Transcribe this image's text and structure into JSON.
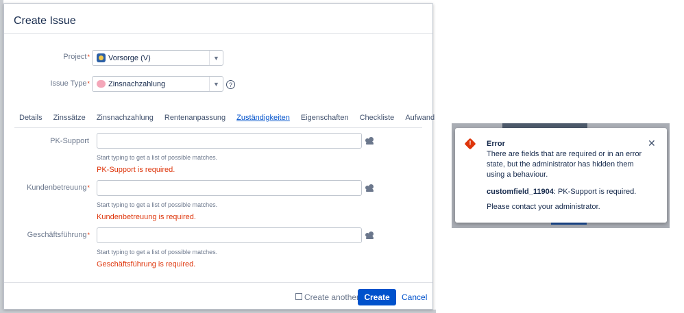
{
  "dialog": {
    "title": "Create Issue",
    "project": {
      "label": "Project",
      "required_mark": "*",
      "value": "Vorsorge (V)"
    },
    "issue_type": {
      "label": "Issue Type",
      "required_mark": "*",
      "value": "Zinsnachzahlung",
      "help": "?"
    },
    "tabs": [
      {
        "label": "Details"
      },
      {
        "label": "Zinssätze"
      },
      {
        "label": "Zinsnachzahlung"
      },
      {
        "label": "Rentenanpassung"
      },
      {
        "label": "Zuständigkeiten",
        "active": true
      },
      {
        "label": "Eigenschaften"
      },
      {
        "label": "Checkliste"
      },
      {
        "label": "Aufwand"
      }
    ],
    "fields": [
      {
        "label": "PK-Support",
        "required_mark": "",
        "value": "",
        "hint": "Start typing to get a list of possible matches.",
        "error": "PK-Support is required."
      },
      {
        "label": "Kundenbetreuung",
        "required_mark": "*",
        "value": "",
        "hint": "Start typing to get a list of possible matches.",
        "error": "Kundenbetreuung is required."
      },
      {
        "label": "Geschäftsführung",
        "required_mark": "*",
        "value": "",
        "hint": "Start typing to get a list of possible matches.",
        "error": "Geschäftsführung is required."
      }
    ],
    "footer": {
      "create_another": "Create another",
      "create_another_checked": false,
      "create_button": "Create",
      "cancel_link": "Cancel"
    }
  },
  "error_panel": {
    "title": "Error",
    "icon": "error-diamond-icon",
    "close": "✕",
    "message": "There are fields that are required or in an error state, but the administrator has hidden them using a behaviour.",
    "detail_field": "customfield_11904",
    "detail_text": ": PK-Support is required.",
    "contact": "Please contact your administrator."
  },
  "colors": {
    "accent": "#0052cc",
    "error": "#de350b",
    "muted": "#6b778c"
  }
}
